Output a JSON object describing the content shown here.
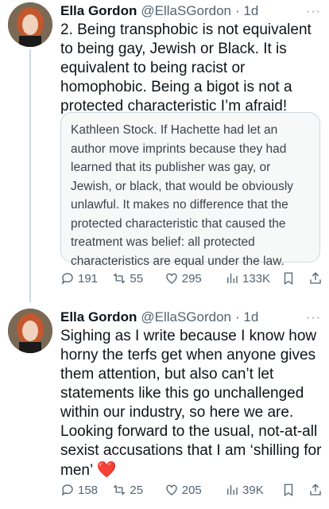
{
  "tweets": [
    {
      "author": "Ella Gordon",
      "handle": "@EllaSGordon",
      "time": "· 1d",
      "text": "2. Being transphobic is not equivalent to being gay, Jewish or Black. It is equivalent to being racist or homophobic. Being a bigot is not a protected characteristic I’m afraid!",
      "quote": "Kathleen Stock. If Hachette had let an author move imprints because they had learned that its publisher was gay, or Jewish, or black, that would be obviously unlawful. It makes no difference that the protected characteristic that caused the treatment was belief: all protected characteristics are equal under the law.",
      "replies": "191",
      "reposts": "55",
      "likes": "295",
      "views": "133K"
    },
    {
      "author": "Ella Gordon",
      "handle": "@EllaSGordon",
      "time": "· 1d",
      "text": "Sighing as I write because I know how horny the terfs get when anyone gives them attention, but also can’t let statements like this go unchallenged within our industry, so here we are. Looking forward to the usual, not-at-all sexist accusations that I am ‘shilling for men’",
      "emoji": "❤️",
      "replies": "158",
      "reposts": "25",
      "likes": "205",
      "views": "39K"
    }
  ],
  "more_label": "···"
}
